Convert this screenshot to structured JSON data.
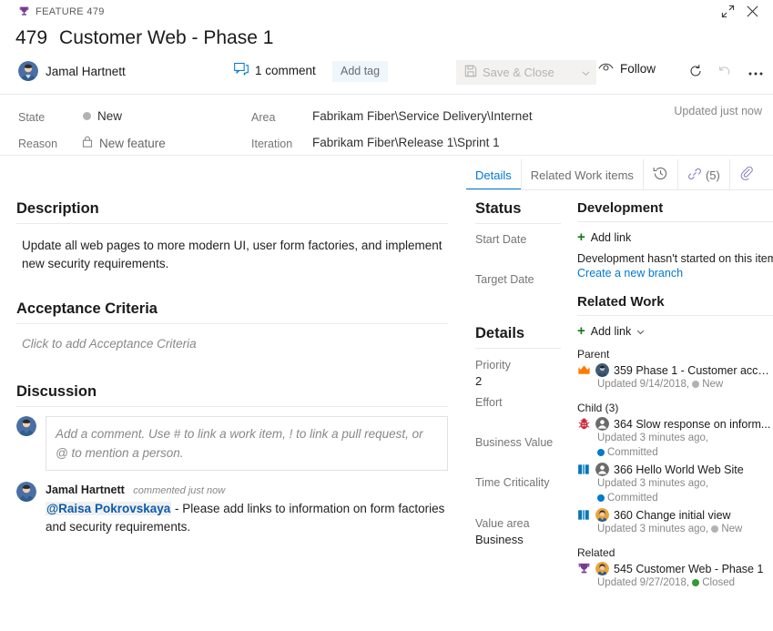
{
  "colors": {
    "feature_purple": "#773b93",
    "accent_blue": "#0078d4",
    "green": "#107c10",
    "epic_orange": "#ff7b00",
    "bug_red": "#cc293d",
    "story_blue": "#009ccc",
    "state_new_gray": "#b2b2b2",
    "state_committed_blue": "#007acc",
    "state_closed_green": "#339933"
  },
  "header": {
    "work_item_type": "FEATURE 479",
    "id": "479",
    "title": "Customer Web - Phase 1",
    "assigned_to": "Jamal Hartnett",
    "comment_count_label": "1 comment",
    "add_tag_label": "Add tag",
    "save_close_label": "Save & Close",
    "follow_label": "Follow",
    "updated_label": "Updated just now"
  },
  "fields": {
    "state_label": "State",
    "state_value": "New",
    "reason_label": "Reason",
    "reason_value": "New feature",
    "area_label": "Area",
    "area_value": "Fabrikam Fiber\\Service Delivery\\Internet",
    "iteration_label": "Iteration",
    "iteration_value": "Fabrikam Fiber\\Release 1\\Sprint 1"
  },
  "tabs": [
    {
      "label": "Details",
      "active": true
    },
    {
      "label": "Related Work items",
      "active": false
    },
    {
      "label": "",
      "icon": "history-icon",
      "active": false
    },
    {
      "label": "(5)",
      "icon": "link-icon",
      "active": false
    },
    {
      "label": "",
      "icon": "attachment-icon",
      "active": false
    }
  ],
  "left": {
    "description_title": "Description",
    "description_body": "Update all web pages to more modern UI, user form factories, and implement new security requirements.",
    "acceptance_title": "Acceptance Criteria",
    "acceptance_placeholder": "Click to add Acceptance Criteria",
    "discussion_title": "Discussion",
    "comment_placeholder": "Add a comment. Use # to link a work item, ! to link a pull request, or @ to mention a person.",
    "comment": {
      "author": "Jamal Hartnett",
      "when": "commented just now",
      "mention": "@Raisa Pokrovskaya",
      "text": " - Please add links to information on form factories and security requirements."
    }
  },
  "middle": {
    "status_title": "Status",
    "start_date_label": "Start Date",
    "start_date_value": "",
    "target_date_label": "Target Date",
    "target_date_value": "",
    "details_title": "Details",
    "priority_label": "Priority",
    "priority_value": "2",
    "effort_label": "Effort",
    "effort_value": "",
    "business_value_label": "Business Value",
    "business_value_value": "",
    "time_criticality_label": "Time Criticality",
    "time_criticality_value": "",
    "value_area_label": "Value area",
    "value_area_value": "Business"
  },
  "right": {
    "development_title": "Development",
    "dev_add_link": "Add link",
    "dev_note": "Development hasn't started on this item.",
    "dev_create_branch": "Create a new branch",
    "related_work_title": "Related Work",
    "rw_add_link": "Add link",
    "groups": [
      {
        "group_label": "Parent",
        "items": [
          {
            "type_icon": "epic-crown-icon",
            "avatar": "avatar-dark",
            "id": "359",
            "title": "Phase 1 - Customer acce...",
            "updated": "Updated 9/14/2018,",
            "state": "New",
            "state_color": "#b2b2b2",
            "wrapped": false
          }
        ]
      },
      {
        "group_label": "Child (3)",
        "items": [
          {
            "type_icon": "bug-icon",
            "avatar": "avatar-gray",
            "id": "364",
            "title": "Slow response on inform...",
            "updated": "Updated 3 minutes ago,",
            "state": "Committed",
            "state_color": "#007acc",
            "wrapped": true
          },
          {
            "type_icon": "user-story-icon",
            "avatar": "avatar-gray",
            "id": "366",
            "title": "Hello World Web Site",
            "updated": "Updated 3 minutes ago,",
            "state": "Committed",
            "state_color": "#007acc",
            "wrapped": true
          },
          {
            "type_icon": "user-story-icon",
            "avatar": "avatar-orange",
            "id": "360",
            "title": "Change initial view",
            "updated": "Updated 3 minutes ago,",
            "state": "New",
            "state_color": "#b2b2b2",
            "wrapped": false
          }
        ]
      },
      {
        "group_label": "Related",
        "items": [
          {
            "type_icon": "feature-trophy-icon",
            "avatar": "avatar-orange",
            "id": "545",
            "title": "Customer Web - Phase 1",
            "updated": "Updated 9/27/2018,",
            "state": "Closed",
            "state_color": "#339933",
            "wrapped": false
          }
        ]
      }
    ]
  }
}
